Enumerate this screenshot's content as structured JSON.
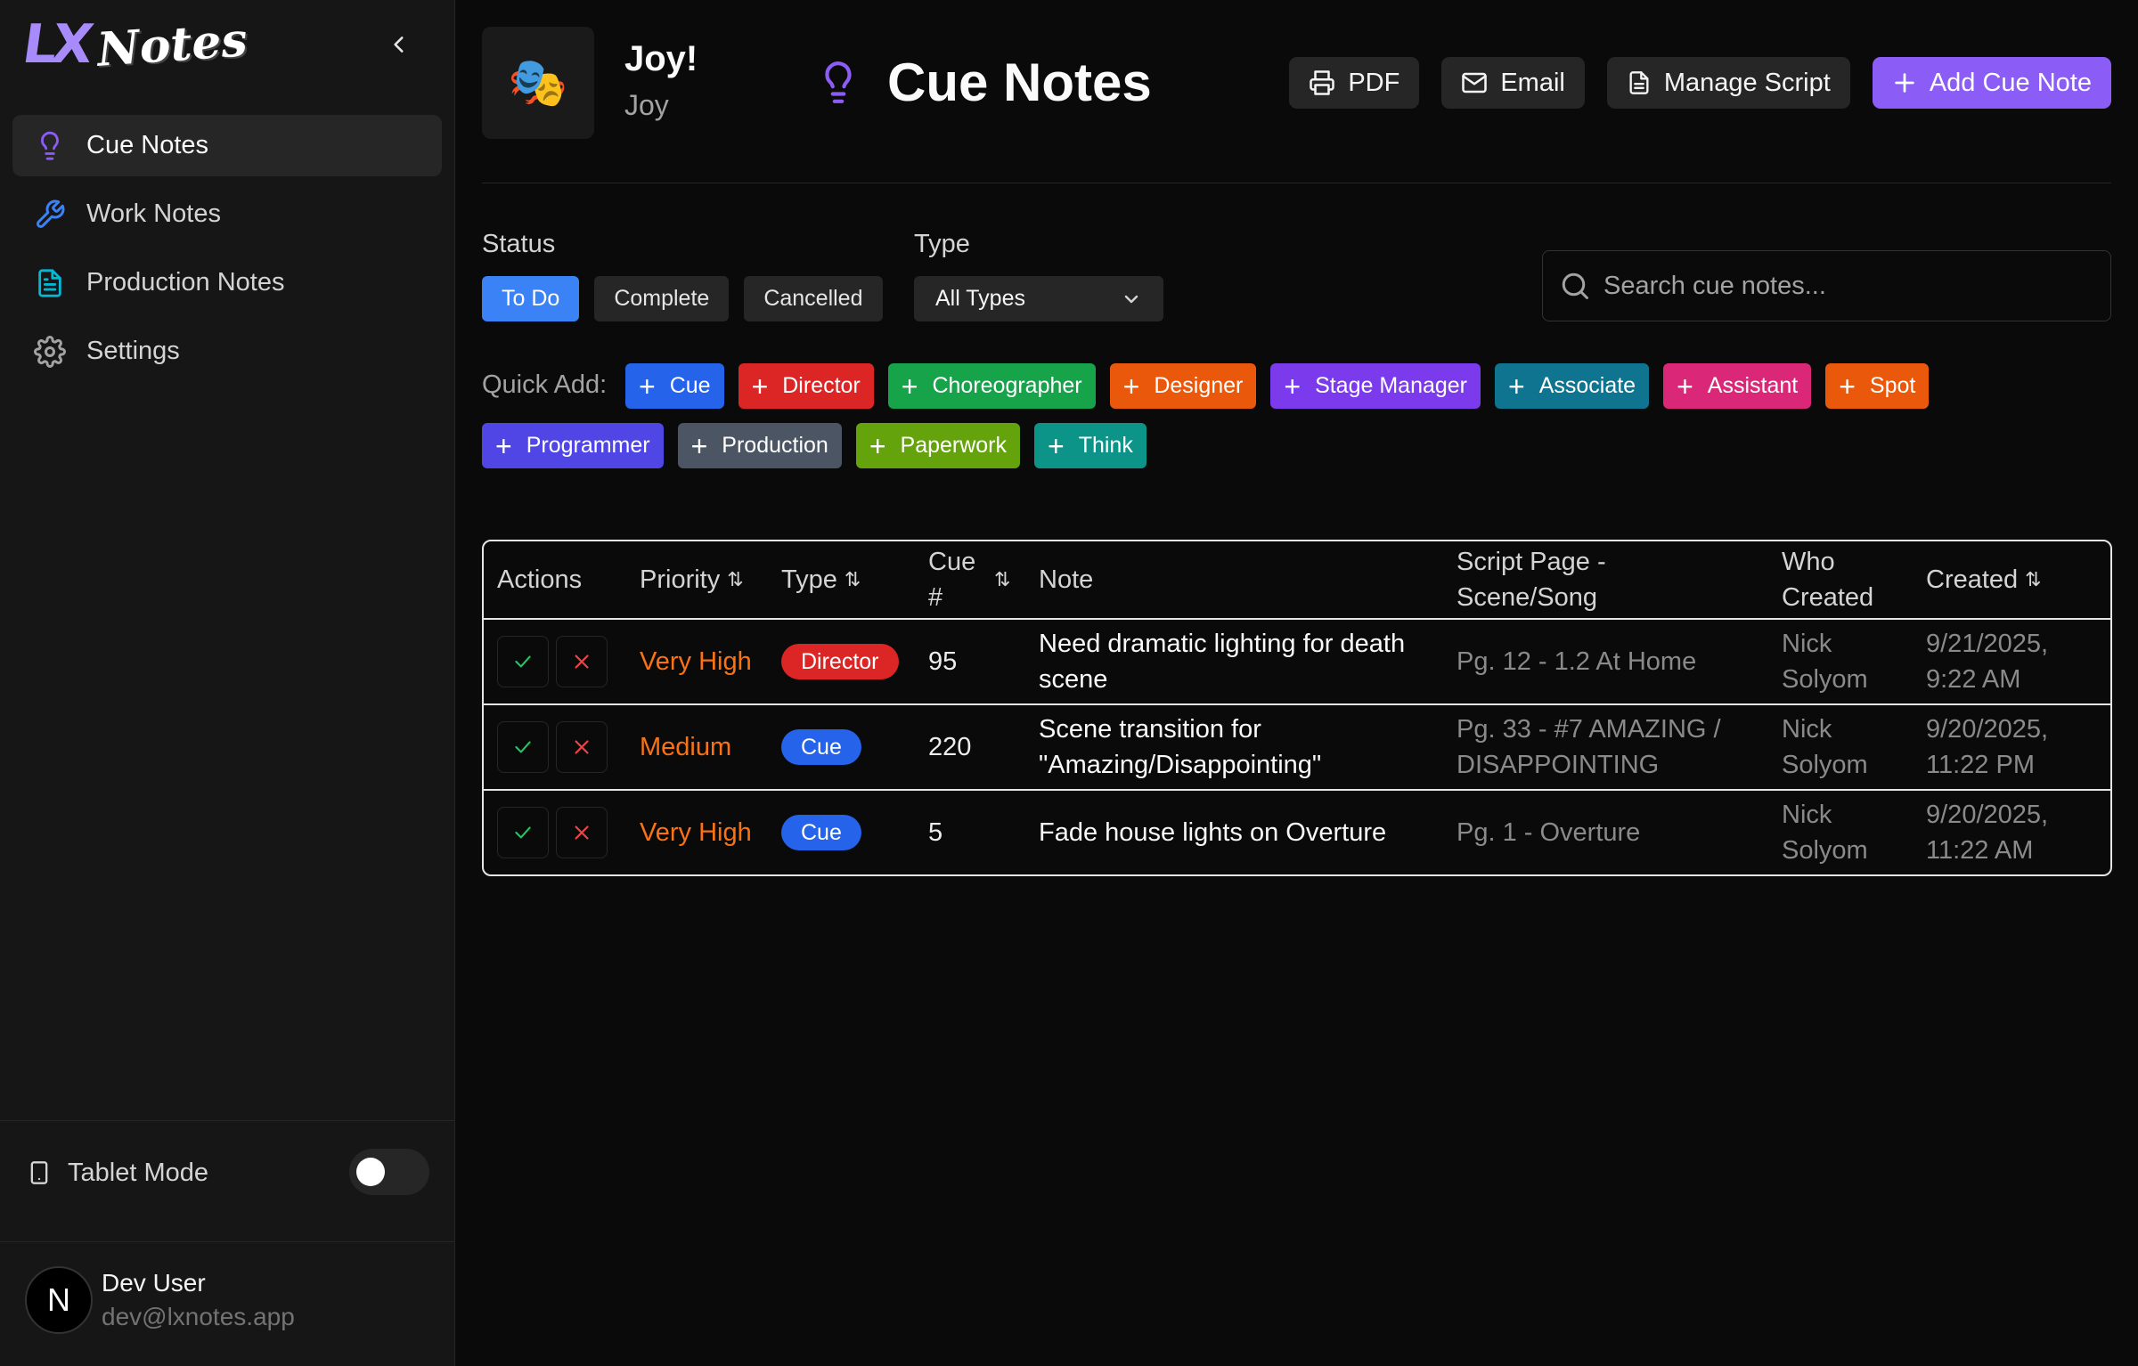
{
  "brand": {
    "lx": "LX",
    "notes": "Notes"
  },
  "sidebar": {
    "items": [
      {
        "label": "Cue Notes",
        "icon": "lightbulb-icon",
        "active": true
      },
      {
        "label": "Work Notes",
        "icon": "wrench-icon",
        "active": false
      },
      {
        "label": "Production Notes",
        "icon": "document-icon",
        "active": false
      },
      {
        "label": "Settings",
        "icon": "gear-icon",
        "active": false
      }
    ],
    "tablet_mode_label": "Tablet Mode",
    "tablet_mode_on": false,
    "user": {
      "initial": "N",
      "name": "Dev User",
      "email": "dev@lxnotes.app"
    }
  },
  "production": {
    "title": "Joy!",
    "subtitle": "Joy",
    "logo_icon": "theater-masks-icon"
  },
  "header": {
    "title": "Cue Notes",
    "pdf_label": "PDF",
    "email_label": "Email",
    "manage_script_label": "Manage Script",
    "add_label": "Add Cue Note"
  },
  "filters": {
    "status_label": "Status",
    "statuses": [
      "To Do",
      "Complete",
      "Cancelled"
    ],
    "active_status": "To Do",
    "type_label": "Type",
    "type_value": "All Types",
    "search_placeholder": "Search cue notes..."
  },
  "quick_add": {
    "label": "Quick Add:",
    "items": [
      {
        "label": "Cue",
        "color": "#2563eb"
      },
      {
        "label": "Director",
        "color": "#dc2626"
      },
      {
        "label": "Choreographer",
        "color": "#16a34a"
      },
      {
        "label": "Designer",
        "color": "#ea580c"
      },
      {
        "label": "Stage Manager",
        "color": "#7c3aed"
      },
      {
        "label": "Associate",
        "color": "#0e7490"
      },
      {
        "label": "Assistant",
        "color": "#db2777"
      },
      {
        "label": "Spot",
        "color": "#ea580c"
      },
      {
        "label": "Programmer",
        "color": "#4f46e5"
      },
      {
        "label": "Production",
        "color": "#4b5563"
      },
      {
        "label": "Paperwork",
        "color": "#65a30d"
      },
      {
        "label": "Think",
        "color": "#0d9488"
      }
    ]
  },
  "table": {
    "headers": {
      "actions": "Actions",
      "priority": "Priority",
      "type": "Type",
      "cue": "Cue #",
      "note": "Note",
      "script": "Script Page - Scene/Song",
      "who": "Who Created",
      "created": "Created"
    },
    "rows": [
      {
        "priority": "Very High",
        "type": "Director",
        "type_color": "#dc2626",
        "cue": "95",
        "note": "Need dramatic lighting for death scene",
        "script": "Pg. 12 - 1.2 At Home",
        "who": "Nick Solyom",
        "created": "9/21/2025, 9:22 AM"
      },
      {
        "priority": "Medium",
        "type": "Cue",
        "type_color": "#2563eb",
        "cue": "220",
        "note": "Scene transition for \"Amazing/Disappointing\"",
        "script": "Pg. 33 - #7 AMAZING / DISAPPOINTING",
        "who": "Nick Solyom",
        "created": "9/20/2025, 11:22 PM"
      },
      {
        "priority": "Very High",
        "type": "Cue",
        "type_color": "#2563eb",
        "cue": "5",
        "note": "Fade house lights on Overture",
        "script": "Pg. 1 - Overture",
        "who": "Nick Solyom",
        "created": "9/20/2025, 11:22 AM"
      }
    ]
  },
  "colors": {
    "accent": "#8b5cf6",
    "active_status": "#3b82f6",
    "priority": "#f97316"
  }
}
